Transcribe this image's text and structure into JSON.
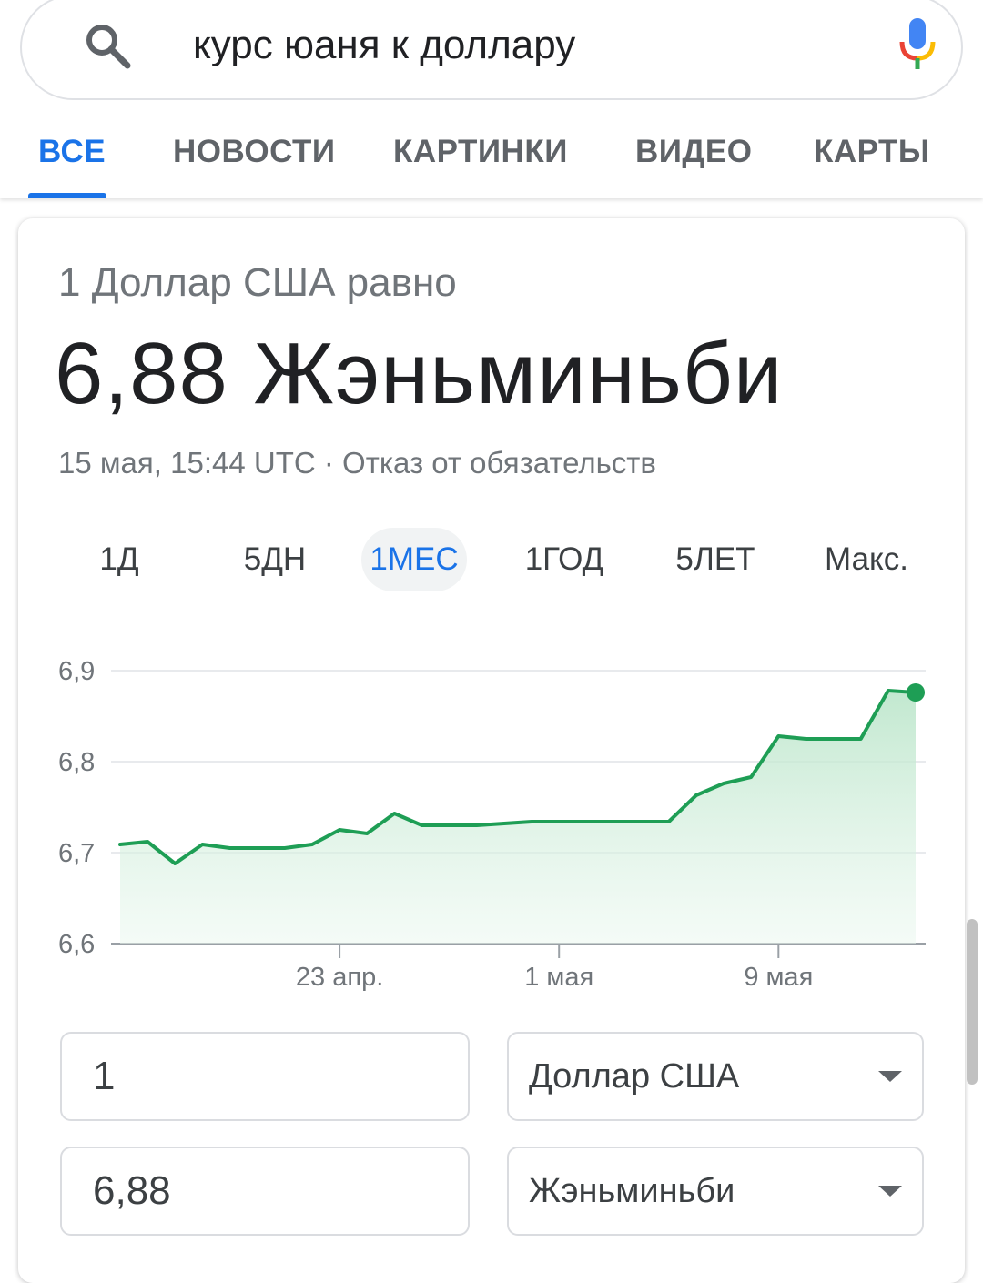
{
  "search": {
    "query": "курс юаня к доллару"
  },
  "tabs": [
    {
      "label": "ВСЕ",
      "active": true
    },
    {
      "label": "НОВОСТИ",
      "active": false
    },
    {
      "label": "КАРТИНКИ",
      "active": false
    },
    {
      "label": "ВИДЕО",
      "active": false
    },
    {
      "label": "КАРТЫ",
      "active": false
    }
  ],
  "converter_card": {
    "subtitle": "1 Доллар США равно",
    "rate": "6,88 Жэньминьби",
    "timestamp": "15 мая, 15:44 UTC",
    "separator": " · ",
    "disclaimer": "Отказ от обязательств",
    "ranges": [
      {
        "label": "1Д",
        "active": false
      },
      {
        "label": "5ДН",
        "active": false
      },
      {
        "label": "1МЕС",
        "active": true
      },
      {
        "label": "1ГОД",
        "active": false
      },
      {
        "label": "5ЛЕТ",
        "active": false
      },
      {
        "label": "Макс.",
        "active": false
      }
    ],
    "amount_from": "1",
    "amount_to": "6,88",
    "currency_from": "Доллар США",
    "currency_to": "Жэньминьби"
  },
  "colors": {
    "accent": "#1a73e8",
    "line": "#1e9e55",
    "fill": "#cfeedd"
  },
  "chart_data": {
    "type": "area",
    "ylim": [
      6.6,
      6.9
    ],
    "yticks": [
      6.6,
      6.7,
      6.8,
      6.9
    ],
    "ytick_labels": [
      "6,6",
      "6,7",
      "6,8",
      "6,9"
    ],
    "x_ticks": [
      {
        "label": "23 апр.",
        "index": 8
      },
      {
        "label": "1 мая",
        "index": 16
      },
      {
        "label": "9 мая",
        "index": 24
      }
    ],
    "values": [
      6.709,
      6.712,
      6.688,
      6.709,
      6.705,
      6.705,
      6.705,
      6.709,
      6.725,
      6.721,
      6.743,
      6.73,
      6.73,
      6.73,
      6.732,
      6.734,
      6.734,
      6.734,
      6.734,
      6.734,
      6.734,
      6.763,
      6.776,
      6.783,
      6.828,
      6.825,
      6.825,
      6.825,
      6.878,
      6.876
    ],
    "grid": true,
    "endpoint_marker": true
  }
}
